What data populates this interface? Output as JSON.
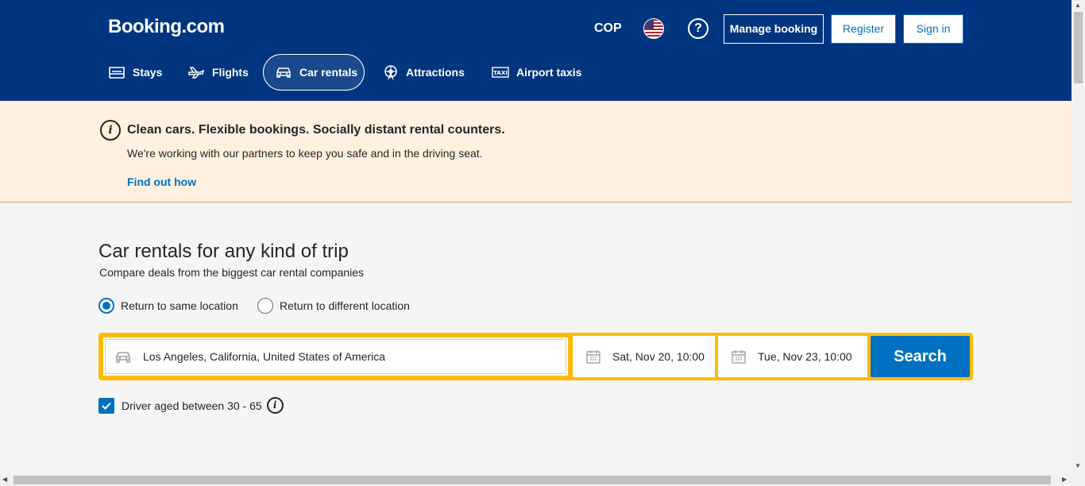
{
  "header": {
    "logo": "Booking.com",
    "currency": "COP",
    "help_icon": "?",
    "manage_booking": "Manage booking",
    "register": "Register",
    "sign_in": "Sign in"
  },
  "nav": {
    "stays": "Stays",
    "flights": "Flights",
    "car_rentals": "Car rentals",
    "attractions": "Attractions",
    "airport_taxis": "Airport taxis"
  },
  "banner": {
    "info_icon": "i",
    "title": "Clean cars. Flexible bookings. Socially distant rental counters.",
    "text": "We're working with our partners to keep you safe and in the driving seat.",
    "link": "Find out how"
  },
  "main": {
    "title": "Car rentals for any kind of trip",
    "subtitle": "Compare deals from the biggest car rental companies",
    "radio_same": "Return to same location",
    "radio_different": "Return to different location",
    "selected_radio": "same"
  },
  "search": {
    "location": "Los Angeles, California, United States of America",
    "pickup": "Sat, Nov 20, 10:00",
    "dropoff": "Tue, Nov 23, 10:00",
    "button": "Search"
  },
  "driver": {
    "label": "Driver aged between 30 - 65",
    "checked": true,
    "info_icon": "i"
  },
  "colors": {
    "brand": "#003580",
    "accent": "#0071c2",
    "search_border": "#febb02",
    "banner_bg": "#fff0e0"
  }
}
